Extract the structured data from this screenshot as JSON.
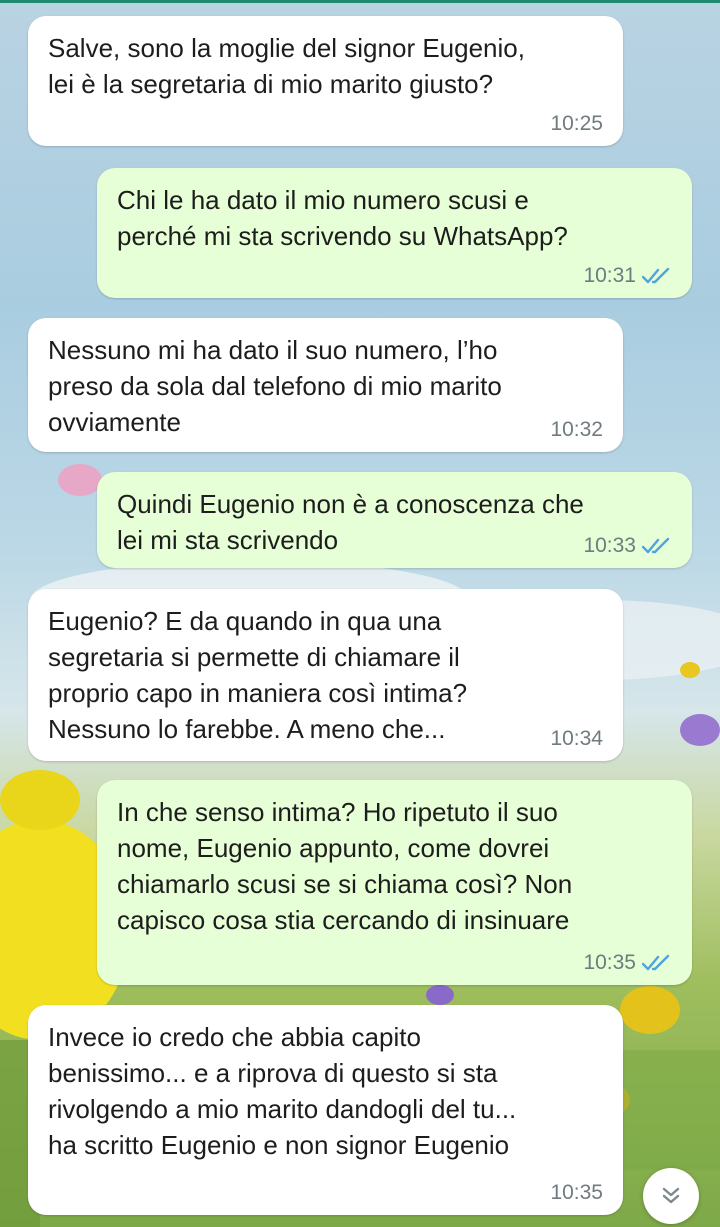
{
  "messages": [
    {
      "dir": "in",
      "text": "Salve, sono la moglie del signor Eugenio,\nlei è la segretaria di mio marito giusto?",
      "time": "10:25"
    },
    {
      "dir": "out",
      "text": "Chi le ha dato il mio numero scusi e\nperché mi sta scrivendo su WhatsApp?",
      "time": "10:31",
      "status": "read"
    },
    {
      "dir": "in",
      "text": "Nessuno mi ha dato il suo numero, l’ho\npreso da sola dal telefono di mio marito\novviamente",
      "time": "10:32"
    },
    {
      "dir": "out",
      "text": "Quindi Eugenio non è a conoscenza che\nlei mi sta scrivendo",
      "time": "10:33",
      "status": "read"
    },
    {
      "dir": "in",
      "text": "Eugenio? E da quando in qua una\nsegretaria si permette di chiamare il\nproprio capo in maniera così intima?\nNessuno lo farebbe. A meno che...",
      "time": "10:34"
    },
    {
      "dir": "out",
      "text": "In che senso intima? Ho ripetuto il suo\nnome, Eugenio appunto, come dovrei\nchiamarlo scusi se si chiama così? Non\ncapisco cosa stia cercando di insinuare",
      "time": "10:35",
      "status": "read"
    },
    {
      "dir": "in",
      "text": "Invece io credo che abbia capito\nbenissimo... e a riprova di questo si sta\nrivolgendo a mio marito dandogli del tu...\nha scritto Eugenio e non signor Eugenio",
      "time": "10:35"
    }
  ],
  "scroll_button": {
    "icon": "double-chevron-down-icon"
  },
  "colors": {
    "outgoing": "#e6ffd6",
    "incoming": "#ffffff",
    "read_ticks": "#4fa3e0",
    "accent_line": "#1f8a70"
  }
}
